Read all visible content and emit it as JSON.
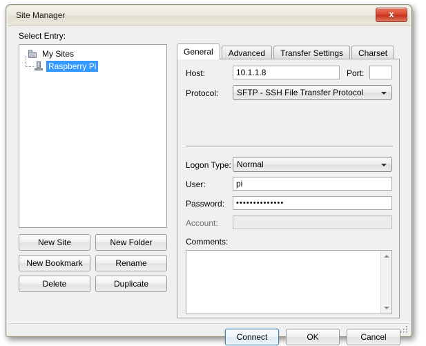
{
  "window": {
    "title": "Site Manager",
    "close_label": "x",
    "close_icon": "close-icon"
  },
  "left_panel": {
    "select_entry_label": "Select Entry:",
    "tree": {
      "root": {
        "label": "My Sites",
        "icon": "folder-icon",
        "expanded": true
      },
      "children": [
        {
          "label": "Raspberry Pi",
          "icon": "server-icon",
          "selected": true
        }
      ]
    },
    "buttons": [
      {
        "label": "New Site",
        "name": "new-site-button"
      },
      {
        "label": "New Folder",
        "name": "new-folder-button"
      },
      {
        "label": "New Bookmark",
        "name": "new-bookmark-button"
      },
      {
        "label": "Rename",
        "name": "rename-button"
      },
      {
        "label": "Delete",
        "name": "delete-button"
      },
      {
        "label": "Duplicate",
        "name": "duplicate-button"
      }
    ]
  },
  "tabs": [
    {
      "label": "General",
      "active": true
    },
    {
      "label": "Advanced",
      "active": false
    },
    {
      "label": "Transfer Settings",
      "active": false
    },
    {
      "label": "Charset",
      "active": false
    }
  ],
  "general_tab": {
    "host": {
      "label": "Host:",
      "value": "10.1.1.8",
      "placeholder": ""
    },
    "port": {
      "label": "Port:",
      "value": "",
      "placeholder": ""
    },
    "protocol": {
      "label": "Protocol:",
      "selected": "SFTP - SSH File Transfer Protocol",
      "dropdown_icon": "chevron-down-icon"
    },
    "logon_type": {
      "label": "Logon Type:",
      "selected": "Normal",
      "dropdown_icon": "chevron-down-icon"
    },
    "user": {
      "label": "User:",
      "value": "pi",
      "placeholder": ""
    },
    "password": {
      "label": "Password:",
      "value": "••••••••••••••",
      "placeholder": ""
    },
    "account": {
      "label": "Account:",
      "value": "",
      "placeholder": "",
      "disabled": true
    },
    "comments": {
      "label": "Comments:",
      "value": "",
      "scroll_up_icon": "scroll-up-arrow-icon",
      "scroll_down_icon": "scroll-down-arrow-icon"
    }
  },
  "dialog_buttons": [
    {
      "label": "Connect",
      "name": "connect-button",
      "default": true
    },
    {
      "label": "OK",
      "name": "ok-button",
      "default": false
    },
    {
      "label": "Cancel",
      "name": "cancel-button",
      "default": false
    }
  ],
  "colors": {
    "selection_blue": "#3399ff",
    "close_red": "#c62f18",
    "dialog_background": "#f0f0f0",
    "default_button_border": "#3c7fb1"
  }
}
